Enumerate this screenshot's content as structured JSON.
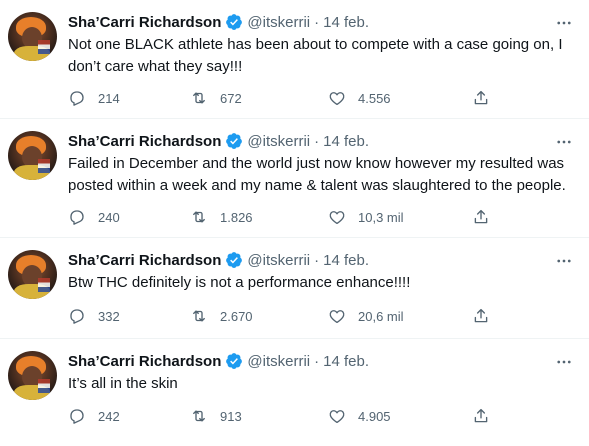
{
  "tweets": [
    {
      "name": "Sha’Carri Richardson",
      "handle": "@itskerrii",
      "dot": "·",
      "date": "14 feb.",
      "text": "Not one BLACK athlete has been about to compete with a case going on, I don’t care what they say!!!",
      "replies": "214",
      "retweets": "672",
      "likes": "4.556"
    },
    {
      "name": "Sha’Carri Richardson",
      "handle": "@itskerrii",
      "dot": "·",
      "date": "14 feb.",
      "text": "Failed in December and the world just now know however my resulted was posted within a week and my name & talent was slaughtered to the people.",
      "replies": "240",
      "retweets": "1.826",
      "likes": "10,3 mil"
    },
    {
      "name": "Sha’Carri Richardson",
      "handle": "@itskerrii",
      "dot": "·",
      "date": "14 feb.",
      "text": "Btw THC definitely is not a performance enhance!!!!",
      "replies": "332",
      "retweets": "2.670",
      "likes": "20,6 mil"
    },
    {
      "name": "Sha’Carri Richardson",
      "handle": "@itskerrii",
      "dot": "·",
      "date": "14 feb.",
      "text": "It’s all in the skin",
      "replies": "242",
      "retweets": "913",
      "likes": "4.905"
    }
  ],
  "icons": {
    "verified": "verified-badge-icon",
    "more": "more-options-icon",
    "reply": "reply-icon",
    "retweet": "retweet-icon",
    "like": "like-heart-icon",
    "share": "share-icon"
  },
  "colors": {
    "verified": "#1d9bf0",
    "text_primary": "#0f1419",
    "text_secondary": "#536471",
    "divider": "#eff3f4"
  }
}
